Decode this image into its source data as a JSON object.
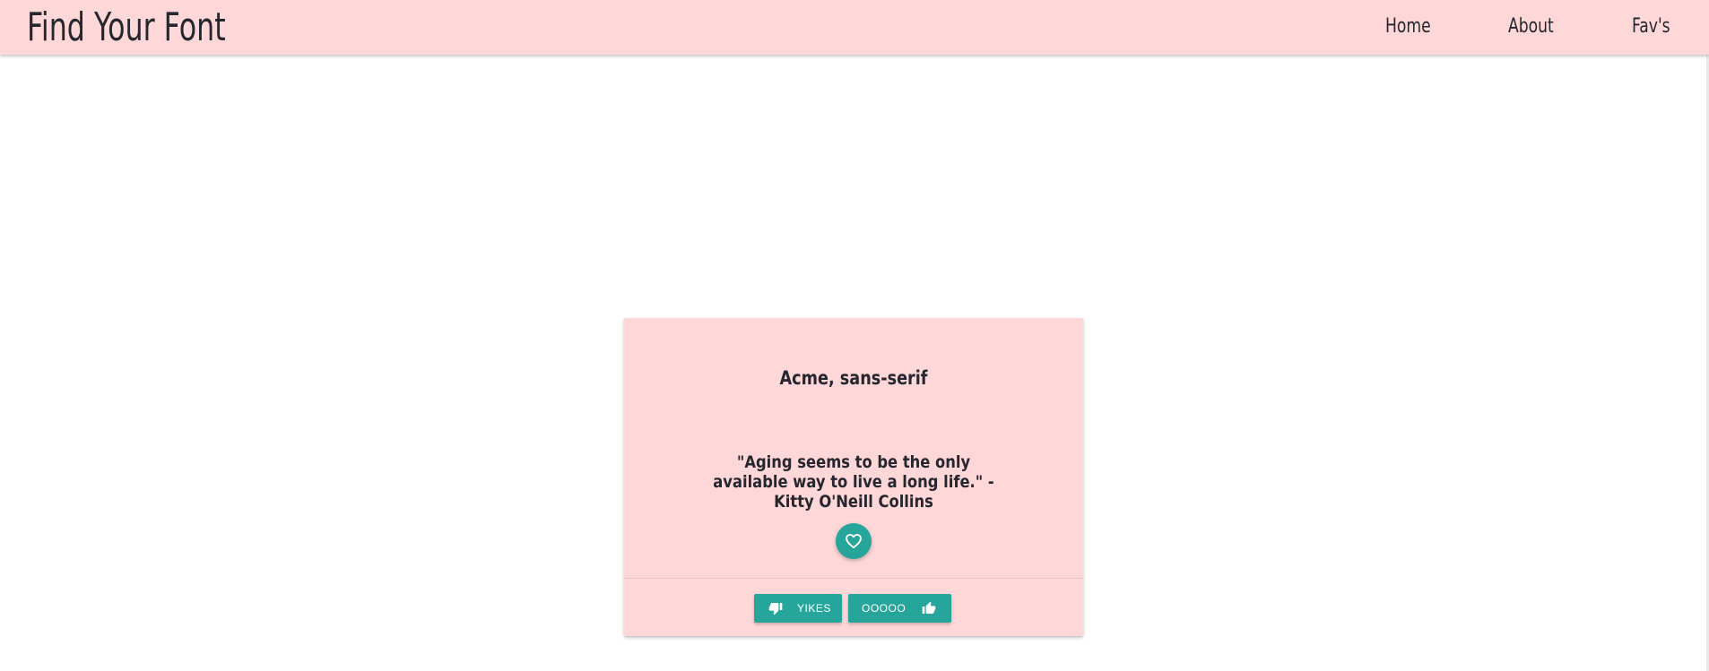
{
  "header": {
    "brand": "Find Your Font",
    "nav": [
      {
        "label": "Home"
      },
      {
        "label": "About"
      },
      {
        "label": "Fav's"
      }
    ]
  },
  "card": {
    "font_name": "Acme, sans-serif",
    "quote": "\"Aging seems to be the only available way to live a long life.\" -Kitty O'Neill Collins",
    "favorite_icon": "heart-outline-icon",
    "buttons": {
      "dislike": {
        "label": "YIKES",
        "icon": "thumb-down-icon"
      },
      "like": {
        "label": "OOOOO",
        "icon": "thumb-up-icon"
      }
    }
  },
  "colors": {
    "navbar_bg": "#fed7d9",
    "card_bg": "#fed7d9",
    "accent": "#26a69a",
    "text": "#26262e"
  }
}
